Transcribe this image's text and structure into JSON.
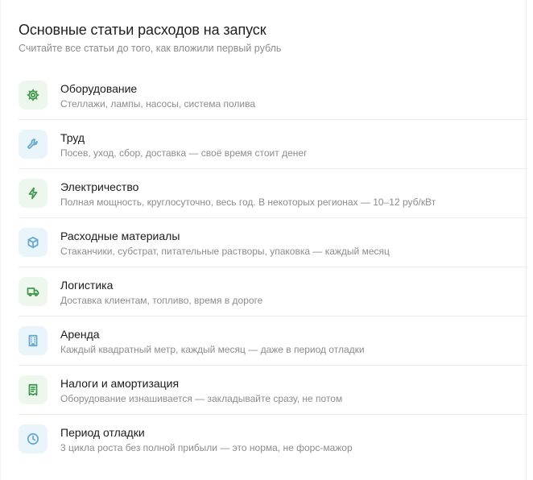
{
  "header": {
    "title": "Основные статьи расходов на запуск",
    "subtitle": "Считайте все статьи до того, как вложили первый рубль"
  },
  "items": [
    {
      "title": "Оборудование",
      "description": "Стеллажи, лампы, насосы, система полива",
      "icon": "gear-icon",
      "tone": "green"
    },
    {
      "title": "Труд",
      "description": "Посев, уход, сбор, доставка — своё время стоит денег",
      "icon": "wrench-icon",
      "tone": "blue"
    },
    {
      "title": "Электричество",
      "description": "Полная мощность, круглосуточно, весь год. В некоторых регионах — 10–12 руб/кВт",
      "icon": "lightning-icon",
      "tone": "green"
    },
    {
      "title": "Расходные материалы",
      "description": "Стаканчики, субстрат, питательные растворы, упаковка — каждый месяц",
      "icon": "box-icon",
      "tone": "blue"
    },
    {
      "title": "Логистика",
      "description": "Доставка клиентам, топливо, время в дороге",
      "icon": "truck-icon",
      "tone": "green"
    },
    {
      "title": "Аренда",
      "description": "Каждый квадратный метр, каждый месяц — даже в период отладки",
      "icon": "building-icon",
      "tone": "blue"
    },
    {
      "title": "Налоги и амортизация",
      "description": "Оборудование изнашивается — закладывайте сразу, не потом",
      "icon": "receipt-icon",
      "tone": "green"
    },
    {
      "title": "Период отладки",
      "description": "3 цикла роста без полной прибыли — это норма, не форс-мажор",
      "icon": "clock-icon",
      "tone": "blue"
    }
  ],
  "colors": {
    "green_icon": "#3f9a4d",
    "green_bg": "#eef7ee",
    "blue_icon": "#6aa9cf",
    "blue_bg": "#e9f4fb",
    "divider": "#ececec",
    "muted_text": "#8c8c8c"
  }
}
